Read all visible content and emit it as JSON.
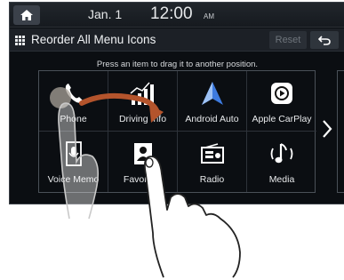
{
  "status": {
    "date": "Jan. 1",
    "time": "12:00",
    "ampm": "AM"
  },
  "header": {
    "title": "Reorder All Menu Icons",
    "reset_label": "Reset"
  },
  "instruction": "Press an item to drag it to another position.",
  "menu_items": [
    {
      "label": "Phone",
      "icon": "phone-icon"
    },
    {
      "label": "Driving Info",
      "icon": "driving-info-icon"
    },
    {
      "label": "Android Auto",
      "icon": "android-auto-icon"
    },
    {
      "label": "Apple CarPlay",
      "icon": "apple-carplay-icon"
    },
    {
      "label": "Voice Memo",
      "icon": "voice-memo-icon"
    },
    {
      "label": "Favorites",
      "icon": "favorites-icon"
    },
    {
      "label": "Radio",
      "icon": "radio-icon"
    },
    {
      "label": "Media",
      "icon": "media-icon"
    }
  ],
  "colors": {
    "screen_bg": "#0b0e12",
    "accent_blue": "#3d7be0",
    "drag_arrow": "#b4542c"
  }
}
